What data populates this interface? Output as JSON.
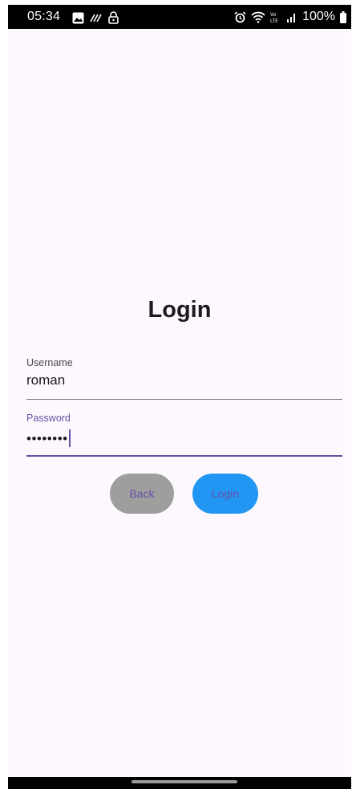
{
  "status_bar": {
    "time": "05:34",
    "battery": "100%",
    "left_icons": [
      "image-icon",
      "handwriting-icon",
      "lock-icon"
    ],
    "right_icons": [
      "alarm-icon",
      "wifi-icon",
      "volte-icon",
      "signal-icon",
      "battery-icon"
    ]
  },
  "login": {
    "title": "Login",
    "username": {
      "label": "Username",
      "value": "roman"
    },
    "password": {
      "label": "Password",
      "masked_value": "••••••••"
    },
    "buttons": {
      "back": "Back",
      "login": "Login"
    }
  },
  "colors": {
    "primary": "#6750a4",
    "back_button": "#9e9e9e",
    "login_button": "#2196f3",
    "background": "#fdf8fd"
  }
}
